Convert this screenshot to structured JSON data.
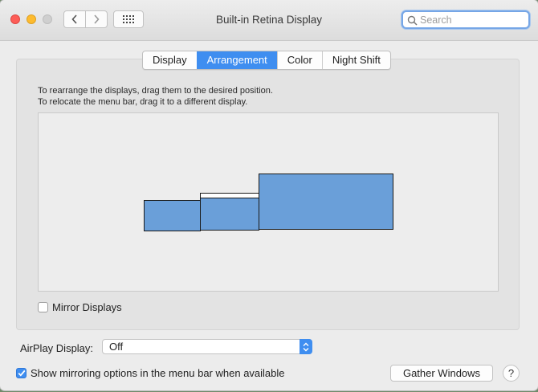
{
  "window": {
    "title": "Built-in Retina Display"
  },
  "search": {
    "placeholder": "Search",
    "value": ""
  },
  "tabs": [
    {
      "label": "Display",
      "active": false
    },
    {
      "label": "Arrangement",
      "active": true
    },
    {
      "label": "Color",
      "active": false
    },
    {
      "label": "Night Shift",
      "active": false
    }
  ],
  "arrangement": {
    "instruction_line1": "To rearrange the displays, drag them to the desired position.",
    "instruction_line2": "To relocate the menu bar, drag it to a different display."
  },
  "mirror": {
    "label": "Mirror Displays",
    "checked": false
  },
  "airplay": {
    "label": "AirPlay Display:",
    "selected": "Off"
  },
  "show_mirroring": {
    "label": "Show mirroring options in the menu bar when available",
    "checked": true
  },
  "buttons": {
    "gather": "Gather Windows",
    "help": "?"
  },
  "colors": {
    "accent": "#3f8ef0",
    "display_fill": "#6a9fd9",
    "close": "#fd5d57",
    "minimize": "#fdbb2e"
  },
  "icons": {
    "back": "chevron-left-icon",
    "forward": "chevron-right-icon",
    "grid": "grid-icon",
    "search": "magnifier-icon"
  }
}
